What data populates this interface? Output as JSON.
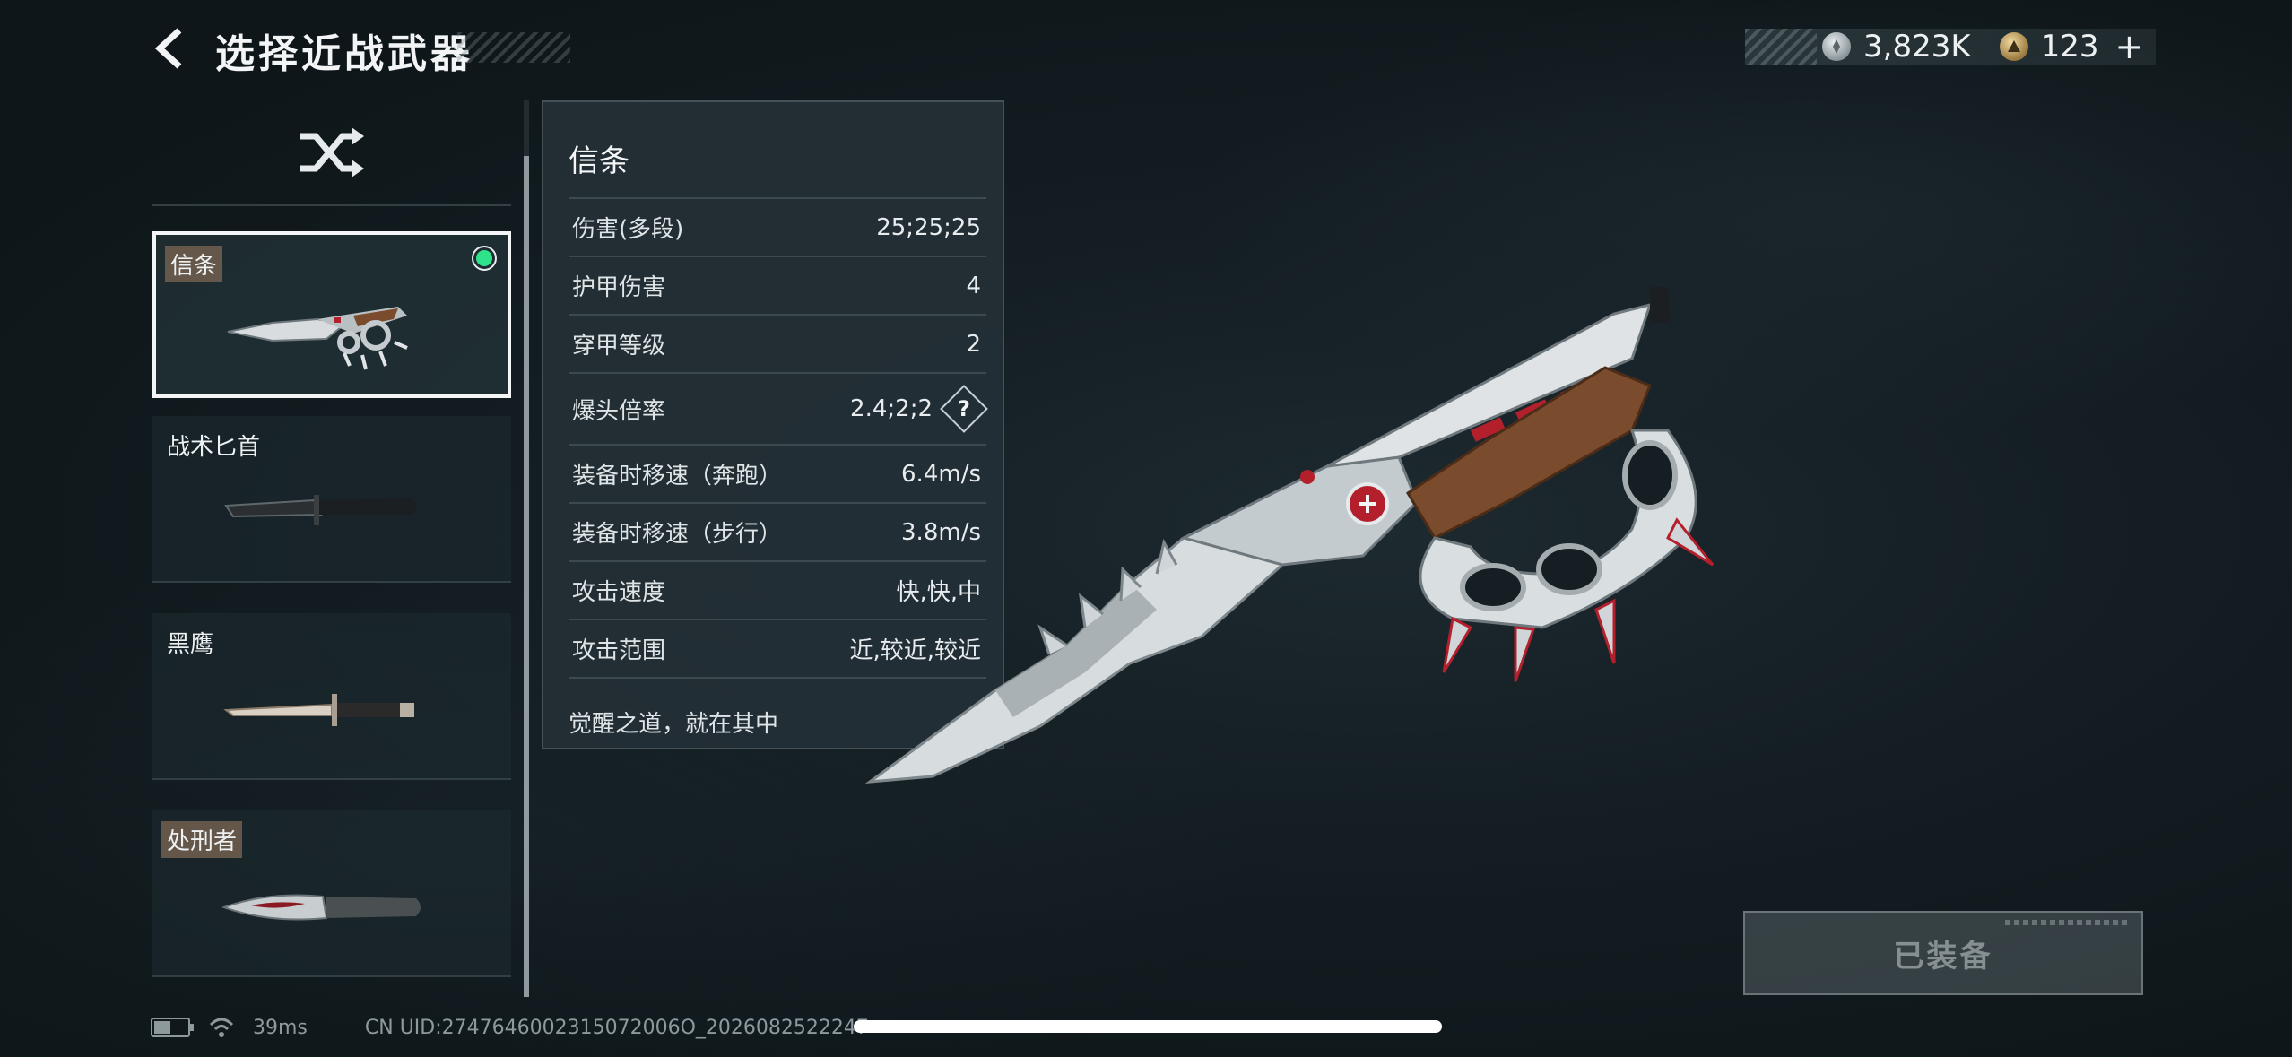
{
  "header": {
    "title": "选择近战武器",
    "currency": [
      {
        "icon": "silver-coin-icon",
        "value": "3,823K"
      },
      {
        "icon": "gold-coin-icon",
        "value": "123"
      }
    ],
    "add_label": "+"
  },
  "weapons": [
    {
      "name": "信条",
      "selected": true,
      "equipped": true,
      "tagged": true
    },
    {
      "name": "战术匕首",
      "selected": false,
      "equipped": false,
      "tagged": false
    },
    {
      "name": "黑鹰",
      "selected": false,
      "equipped": false,
      "tagged": false
    },
    {
      "name": "处刑者",
      "selected": false,
      "equipped": false,
      "tagged": true
    }
  ],
  "stats": {
    "title": "信条",
    "rows": [
      {
        "label": "伤害(多段)",
        "value": "25;25;25"
      },
      {
        "label": "护甲伤害",
        "value": "4"
      },
      {
        "label": "穿甲等级",
        "value": "2"
      },
      {
        "label": "爆头倍率",
        "value": "2.4;2;2",
        "help": "?"
      },
      {
        "label": "装备时移速（奔跑）",
        "value": "6.4m/s"
      },
      {
        "label": "装备时移速（步行）",
        "value": "3.8m/s"
      },
      {
        "label": "攻击速度",
        "value": "快,快,中"
      },
      {
        "label": "攻击范围",
        "value": "近,较近,较近"
      }
    ],
    "description": "觉醒之道，就在其中"
  },
  "equip_button": {
    "label": "已装备"
  },
  "status": {
    "ping": "39ms",
    "uid": "CN UID:2747646002315072006O_2026082522247"
  },
  "colors": {
    "equipped_dot": "#2fe38a",
    "accent_red": "#b3202c"
  }
}
